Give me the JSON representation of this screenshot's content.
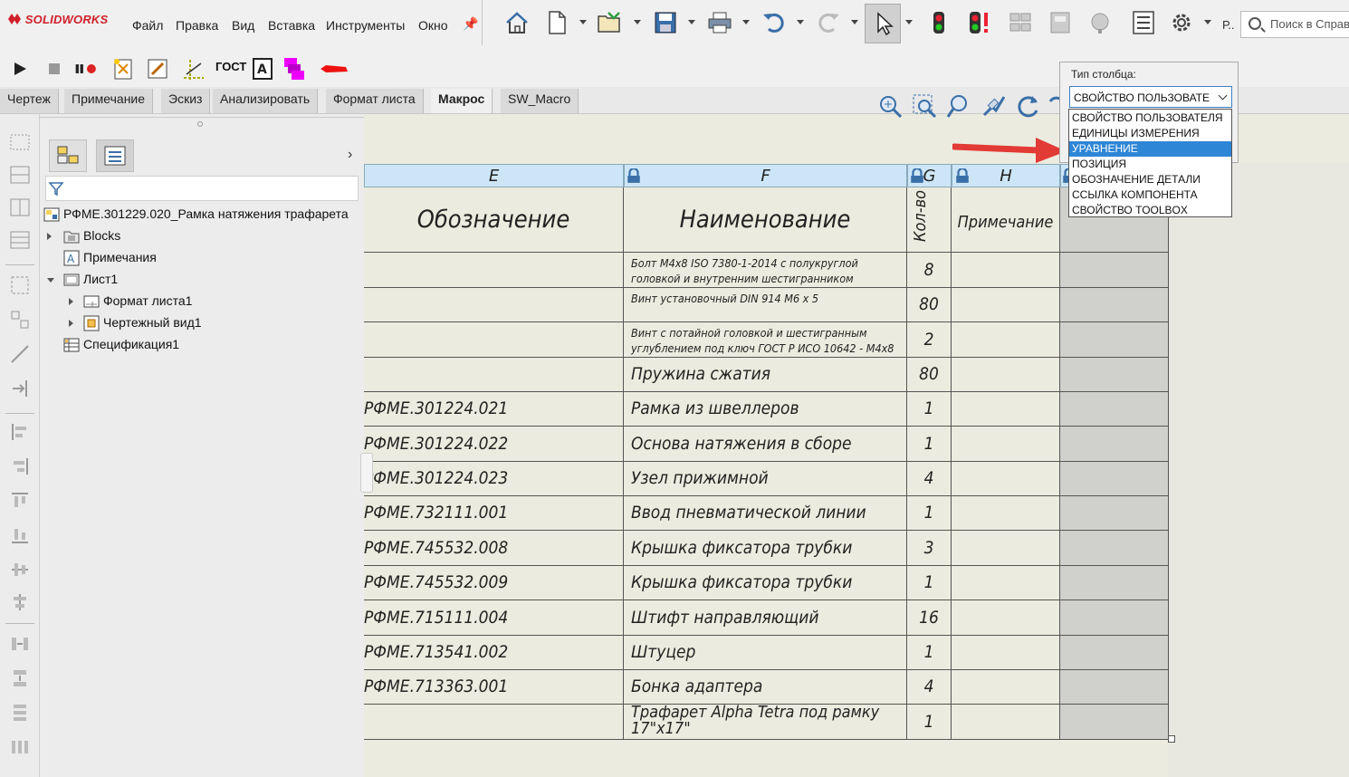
{
  "app": {
    "brand": "SOLIDWORKS",
    "menu": [
      "Файл",
      "Правка",
      "Вид",
      "Вставка",
      "Инструменты",
      "Окно"
    ],
    "search_placeholder": "Поиск в Справ",
    "more_label": "Р.."
  },
  "macro_toolbar": {
    "gost_label": "ГОСТ"
  },
  "tabs": [
    {
      "label": "Чертеж",
      "active": false
    },
    {
      "label": "Примечание",
      "active": false
    },
    {
      "label": "Эскиз",
      "active": false
    },
    {
      "label": "Анализировать",
      "active": false
    },
    {
      "label": "Формат листа",
      "active": false
    },
    {
      "label": "Макрос",
      "active": true
    },
    {
      "label": "SW_Macro",
      "active": false
    }
  ],
  "tree": {
    "root": "РФМЕ.301229.020_Рамка натяжения трафарета",
    "items": [
      {
        "label": "Blocks",
        "level": 1,
        "twisty": "right"
      },
      {
        "label": "Примечания",
        "level": 1,
        "twisty": "none"
      },
      {
        "label": "Лист1",
        "level": 1,
        "twisty": "down"
      },
      {
        "label": "Формат листа1",
        "level": 2,
        "twisty": "right"
      },
      {
        "label": "Чертежный вид1",
        "level": 2,
        "twisty": "right"
      },
      {
        "label": "Спецификация1",
        "level": 1,
        "twisty": "none"
      }
    ]
  },
  "table": {
    "column_letters": [
      "E",
      "F",
      "G",
      "H"
    ],
    "headers": {
      "e": "Обозначение",
      "f": "Наименование",
      "g": "Кол-во",
      "h": "Примечание"
    },
    "rows": [
      {
        "e": "",
        "f": "Болт М4х8 ISO 7380-1-2014 с полукруглой головкой и внутренним шестигранником",
        "g": "8",
        "small": true
      },
      {
        "e": "",
        "f": "Винт установочный DIN 914 M6 x 5",
        "g": "80",
        "small": true
      },
      {
        "e": "",
        "f": "Винт с потайной головкой и шестигранным углублением под ключ ГОСТ Р ИСО 10642 - M4x8",
        "g": "2",
        "small": true
      },
      {
        "e": "",
        "f": "Пружина сжатия",
        "g": "80",
        "small": false
      },
      {
        "e": "РФМЕ.301224.021",
        "f": "Рамка из швеллеров",
        "g": "1",
        "small": false
      },
      {
        "e": "РФМЕ.301224.022",
        "f": "Основа натяжения в сборе",
        "g": "1",
        "small": false
      },
      {
        "e": "РФМЕ.301224.023",
        "f": "Узел прижимной",
        "g": "4",
        "small": false
      },
      {
        "e": "РФМЕ.732111.001",
        "f": "Ввод пневматической линии",
        "g": "1",
        "small": false
      },
      {
        "e": "РФМЕ.745532.008",
        "f": "Крышка фиксатора трубки",
        "g": "3",
        "small": false
      },
      {
        "e": "РФМЕ.745532.009",
        "f": "Крышка фиксатора трубки",
        "g": "1",
        "small": false
      },
      {
        "e": "РФМЕ.715111.004",
        "f": "Штифт направляющий",
        "g": "16",
        "small": false
      },
      {
        "e": "РФМЕ.713541.002",
        "f": "Штуцер",
        "g": "1",
        "small": false
      },
      {
        "e": "РФМЕ.713363.001",
        "f": "Бонка адаптера",
        "g": "4",
        "small": false
      },
      {
        "e": "",
        "f": "Трафарет Alpha Tetra под рамку 17\"x17\"",
        "g": "1",
        "small": false
      }
    ]
  },
  "column_type": {
    "label": "Тип столбца:",
    "selected": "СВОЙСТВО ПОЛЬЗОВАТЕ",
    "options": [
      "СВОЙСТВО ПОЛЬЗОВАТЕЛЯ",
      "ЕДИНИЦЫ ИЗМЕРЕНИЯ",
      "УРАВНЕНИЕ",
      "ПОЗИЦИЯ",
      "ОБОЗНАЧЕНИЕ ДЕТАЛИ",
      "ССЫЛКА КОМПОНЕНТА",
      "СВОЙСТВО TOOLBOX"
    ],
    "highlighted": "УРАВНЕНИЕ"
  },
  "colors": {
    "accent_blue": "#2e86d6",
    "column_header": "#cde6f7",
    "annotation_arrow": "#e23a35",
    "brand_red": "#d0202a"
  }
}
